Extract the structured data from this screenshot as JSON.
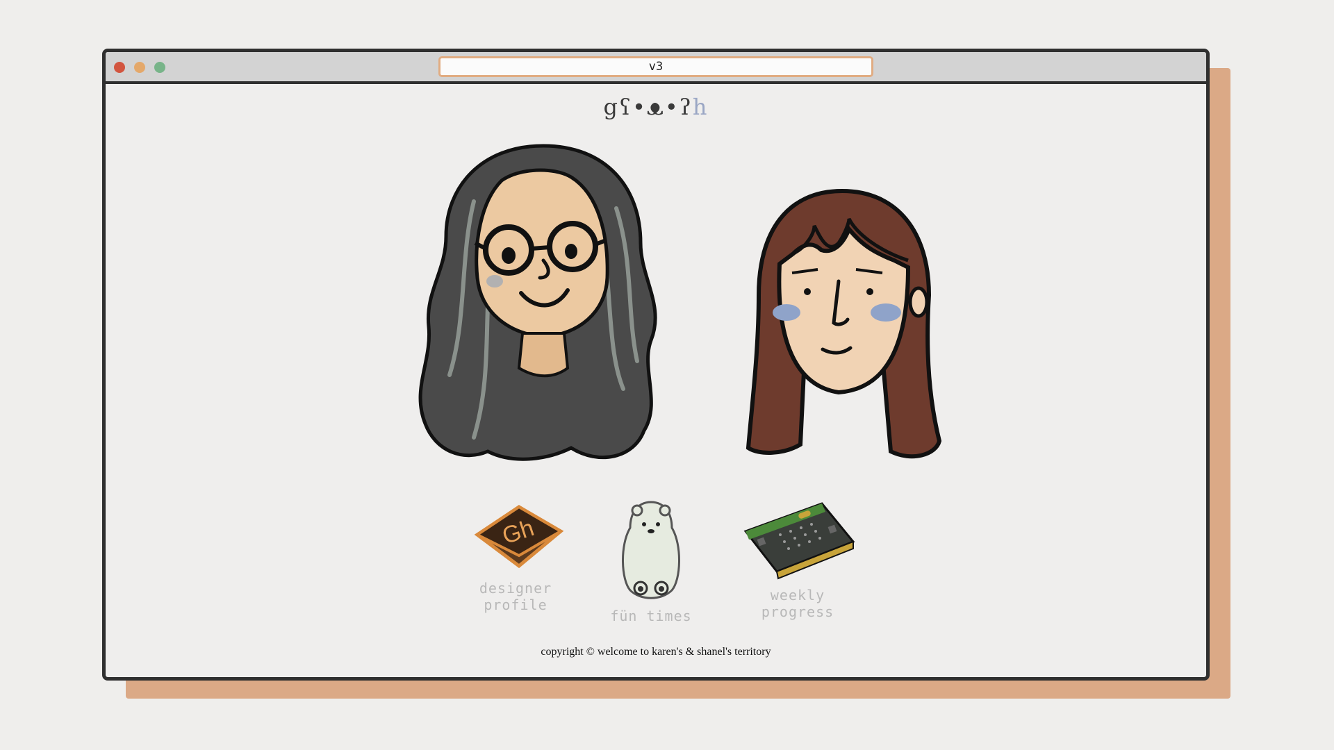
{
  "window": {
    "address": "v3",
    "controls": [
      "close",
      "minimize",
      "maximize"
    ]
  },
  "logo": {
    "text": "gʕ•ᴥ•ʔ",
    "cursor_text": "h"
  },
  "nav": {
    "designer_label": "designer profile",
    "fun_label": "fün times",
    "weekly_label": "weekly progress"
  },
  "footer": {
    "text": "copyright © welcome to karen's & shanel's territory"
  },
  "colors": {
    "page_bg": "#efeeec",
    "shadow": "#dba986",
    "frame": "#2f2f2f",
    "address_border": "#e1ac82",
    "nav_label": "#b8b8b8"
  }
}
